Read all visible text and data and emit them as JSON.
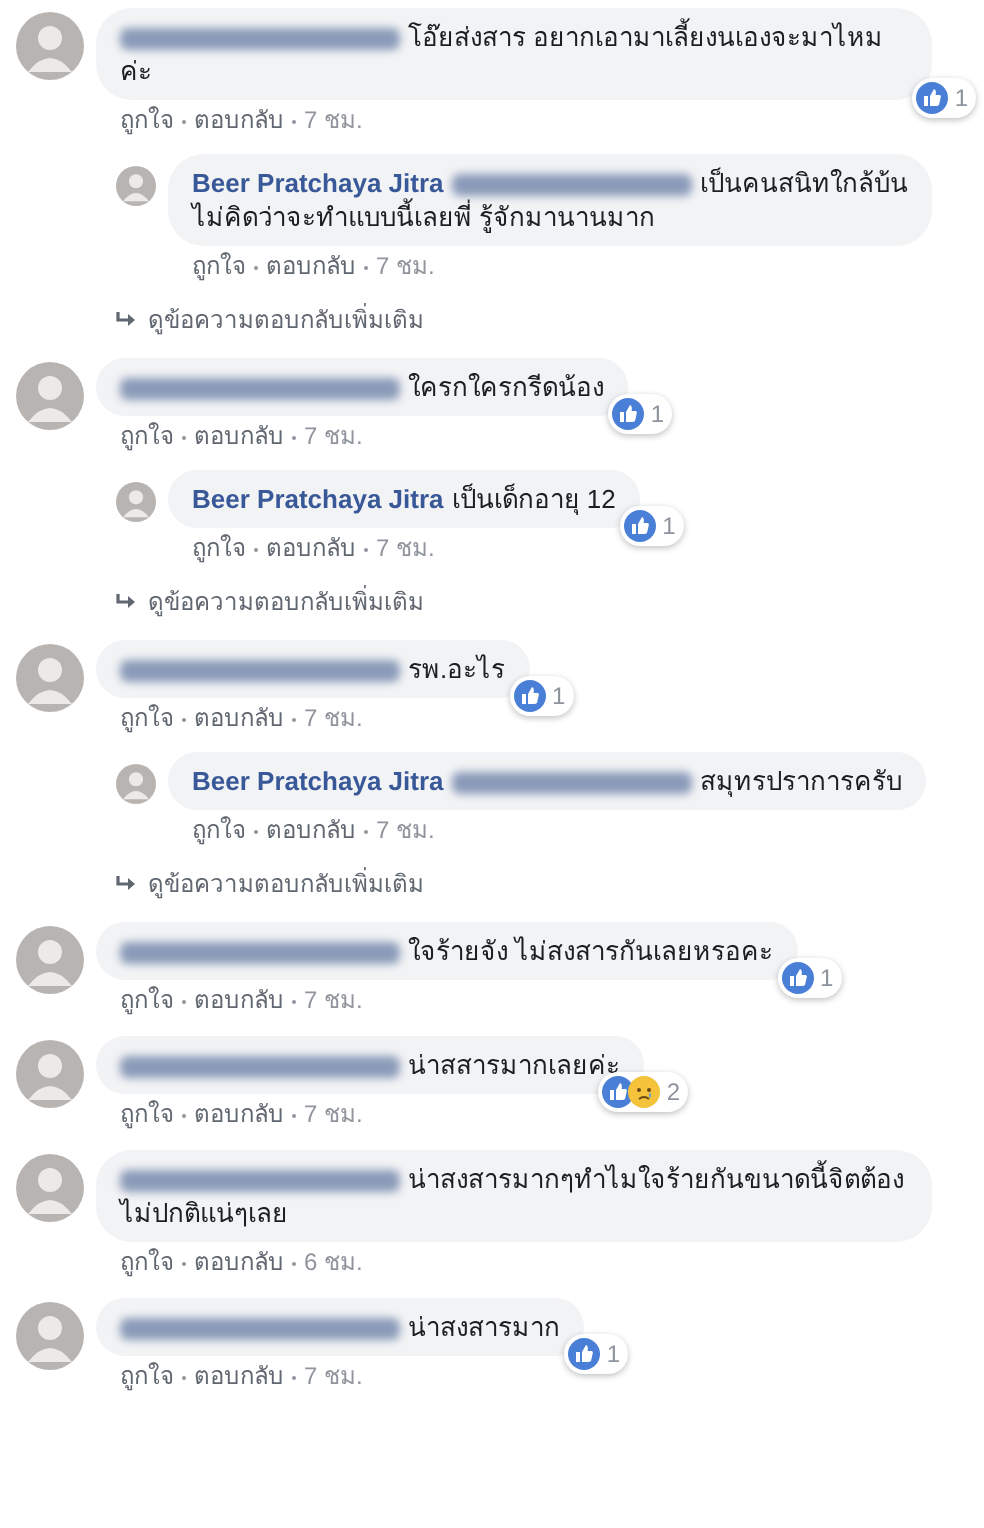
{
  "threads": [
    {
      "comment": {
        "author": {
          "kind": "blurred"
        },
        "text": "โอ๊ยส่งสาร อยากเอามาเลี้ยงนเองจะมาไหมค่ะ",
        "reactions": {
          "icons": [
            {
              "kind": "like"
            }
          ],
          "count": "1"
        },
        "actions": {
          "like": "ถูกใจ",
          "reply": "ตอบกลับ",
          "time": "7 ชม."
        }
      },
      "replies": [
        {
          "author": {
            "kind": "text",
            "text": "Beer Pratchaya Jitra"
          },
          "mention": {
            "kind": "blurred"
          },
          "text": "เป็นคนสนิทใกล้บ้น ไม่คิดว่าจะทำแบบนี้เลยพี่ รู้จักมานานมาก",
          "actions": {
            "like": "ถูกใจ",
            "reply": "ตอบกลับ",
            "time": "7 ชม."
          }
        }
      ],
      "more_replies": "ดูข้อความตอบกลับเพิ่มเติม"
    },
    {
      "comment": {
        "author": {
          "kind": "blurred"
        },
        "text": "ใครกใครกรีดน้อง",
        "reactions": {
          "icons": [
            {
              "kind": "like"
            }
          ],
          "count": "1"
        },
        "actions": {
          "like": "ถูกใจ",
          "reply": "ตอบกลับ",
          "time": "7 ชม."
        }
      },
      "replies": [
        {
          "author": {
            "kind": "text",
            "text": "Beer Pratchaya Jitra"
          },
          "text": "เป็นเด็กอายุ 12",
          "reactions": {
            "icons": [
              {
                "kind": "like"
              }
            ],
            "count": "1"
          },
          "actions": {
            "like": "ถูกใจ",
            "reply": "ตอบกลับ",
            "time": "7 ชม."
          }
        }
      ],
      "more_replies": "ดูข้อความตอบกลับเพิ่มเติม"
    },
    {
      "comment": {
        "author": {
          "kind": "blurred"
        },
        "text": "รพ.อะไร",
        "reactions": {
          "icons": [
            {
              "kind": "like"
            }
          ],
          "count": "1"
        },
        "actions": {
          "like": "ถูกใจ",
          "reply": "ตอบกลับ",
          "time": "7 ชม."
        }
      },
      "replies": [
        {
          "author": {
            "kind": "text",
            "text": "Beer Pratchaya Jitra"
          },
          "mention": {
            "kind": "blurred"
          },
          "text": "สมุทรปราการครับ",
          "actions": {
            "like": "ถูกใจ",
            "reply": "ตอบกลับ",
            "time": "7 ชม."
          }
        }
      ],
      "more_replies": "ดูข้อความตอบกลับเพิ่มเติม"
    },
    {
      "comment": {
        "author": {
          "kind": "blurred"
        },
        "text": "ใจร้ายจัง ไม่สงสารกันเลยหรอคะ",
        "reactions": {
          "icons": [
            {
              "kind": "like"
            }
          ],
          "count": "1"
        },
        "actions": {
          "like": "ถูกใจ",
          "reply": "ตอบกลับ",
          "time": "7 ชม."
        }
      }
    },
    {
      "comment": {
        "author": {
          "kind": "blurred"
        },
        "text": "น่าสสารมากเลยค่ะ",
        "reactions": {
          "icons": [
            {
              "kind": "like"
            },
            {
              "kind": "sad"
            }
          ],
          "count": "2"
        },
        "actions": {
          "like": "ถูกใจ",
          "reply": "ตอบกลับ",
          "time": "7 ชม."
        }
      }
    },
    {
      "comment": {
        "author": {
          "kind": "blurred"
        },
        "text": "น่าสงสารมากๆทำไมใจร้ายกันขนาดนี้จิตต้องไม่ปกติแน่ๆเลย",
        "actions": {
          "like": "ถูกใจ",
          "reply": "ตอบกลับ",
          "time": "6 ชม."
        }
      }
    },
    {
      "comment": {
        "author": {
          "kind": "blurred"
        },
        "text": "น่าสงสารมาก",
        "reactions": {
          "icons": [
            {
              "kind": "like"
            }
          ],
          "count": "1"
        },
        "actions": {
          "like": "ถูกใจ",
          "reply": "ตอบกลับ",
          "time": "7 ชม."
        }
      }
    }
  ]
}
